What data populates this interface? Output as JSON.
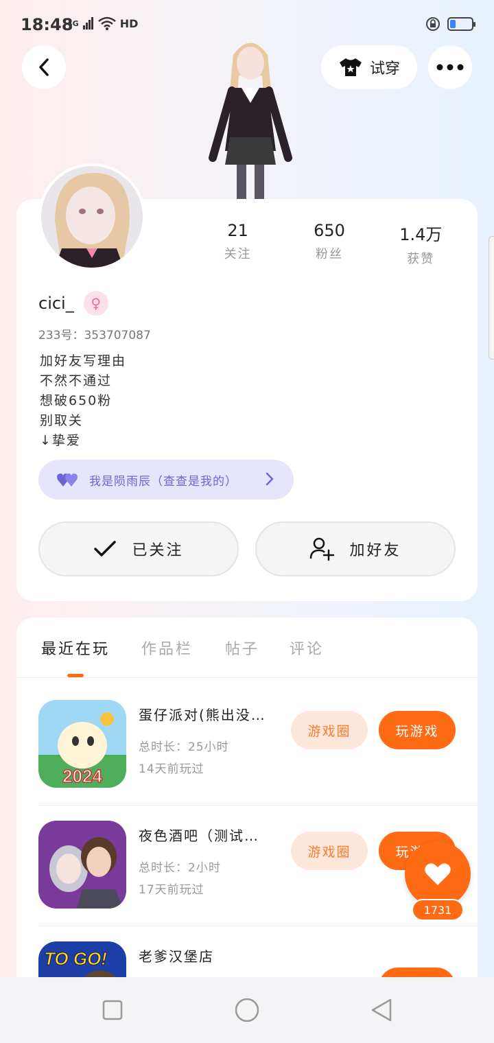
{
  "status": {
    "time": "18:48",
    "network": "4G",
    "hd": "HD",
    "battery_level": 0.25
  },
  "header": {
    "try_on_label": "试穿"
  },
  "profile": {
    "stats": [
      {
        "value": "21",
        "label": "关注"
      },
      {
        "value": "650",
        "label": "粉丝"
      },
      {
        "value": "1.4万",
        "label": "获赞"
      }
    ],
    "username": "cici_",
    "gender_symbol": "♀",
    "uid": "233号：353707087",
    "bio": [
      "加好友写理由",
      "不然不通过",
      "想破650粉",
      "别取关",
      "↓挚爱"
    ],
    "cp_text": "我是陨雨辰（查查是我的）",
    "follow_label": "已关注",
    "add_friend_label": "加好友"
  },
  "tabs": [
    "最近在玩",
    "作品栏",
    "帖子",
    "评论"
  ],
  "games": [
    {
      "title": "蛋仔派对(熊出没…",
      "total_time": "总时长：25小时",
      "last_played": "14天前玩过",
      "circle_label": "游戏圈",
      "play_label": "玩游戏",
      "icon_text": "2024"
    },
    {
      "title": "夜色酒吧（测试…",
      "total_time": "总时长：2小时",
      "last_played": "17天前玩过",
      "circle_label": "游戏圈",
      "play_label": "玩游戏"
    },
    {
      "title": "老爹汉堡店",
      "icon_text": "TO GO!"
    }
  ],
  "like_count": "1731",
  "colors": {
    "accent": "#ff6a14",
    "cp": "#6e63d9",
    "pink": "#f06a9a"
  }
}
